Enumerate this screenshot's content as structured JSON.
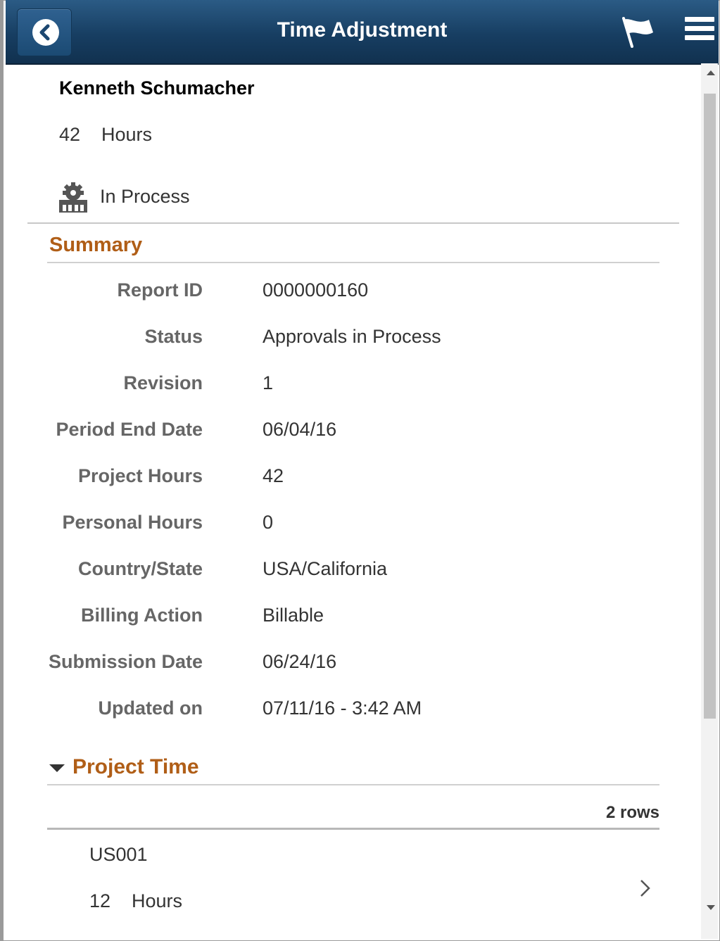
{
  "header": {
    "title": "Time Adjustment",
    "back_icon": "chevron-left-icon",
    "flag_icon": "flag-icon",
    "menu_icon": "hamburger-menu-icon",
    "bg_color": "#1c4770"
  },
  "employee": {
    "name": "Kenneth Schumacher",
    "hours_value": "42",
    "hours_unit": "Hours",
    "status_icon": "gear-building-icon",
    "status": "In Process"
  },
  "summary": {
    "title": "Summary",
    "fields": [
      {
        "label": "Report ID",
        "value": "0000000160"
      },
      {
        "label": "Status",
        "value": "Approvals in Process"
      },
      {
        "label": "Revision",
        "value": "1"
      },
      {
        "label": "Period End Date",
        "value": "06/04/16"
      },
      {
        "label": "Project Hours",
        "value": "42"
      },
      {
        "label": "Personal Hours",
        "value": "0"
      },
      {
        "label": "Country/State",
        "value": "USA/California"
      },
      {
        "label": "Billing Action",
        "value": "Billable"
      },
      {
        "label": "Submission Date",
        "value": "06/24/16"
      },
      {
        "label": "Updated on",
        "value": "07/11/16 - 3:42 AM"
      }
    ]
  },
  "project_time": {
    "title": "Project Time",
    "rows_label": "2 rows",
    "items": [
      {
        "id": "US001",
        "hours_value": "12",
        "hours_unit": "Hours"
      }
    ]
  },
  "colors": {
    "section_title": "#b05e17",
    "label": "#666666"
  }
}
